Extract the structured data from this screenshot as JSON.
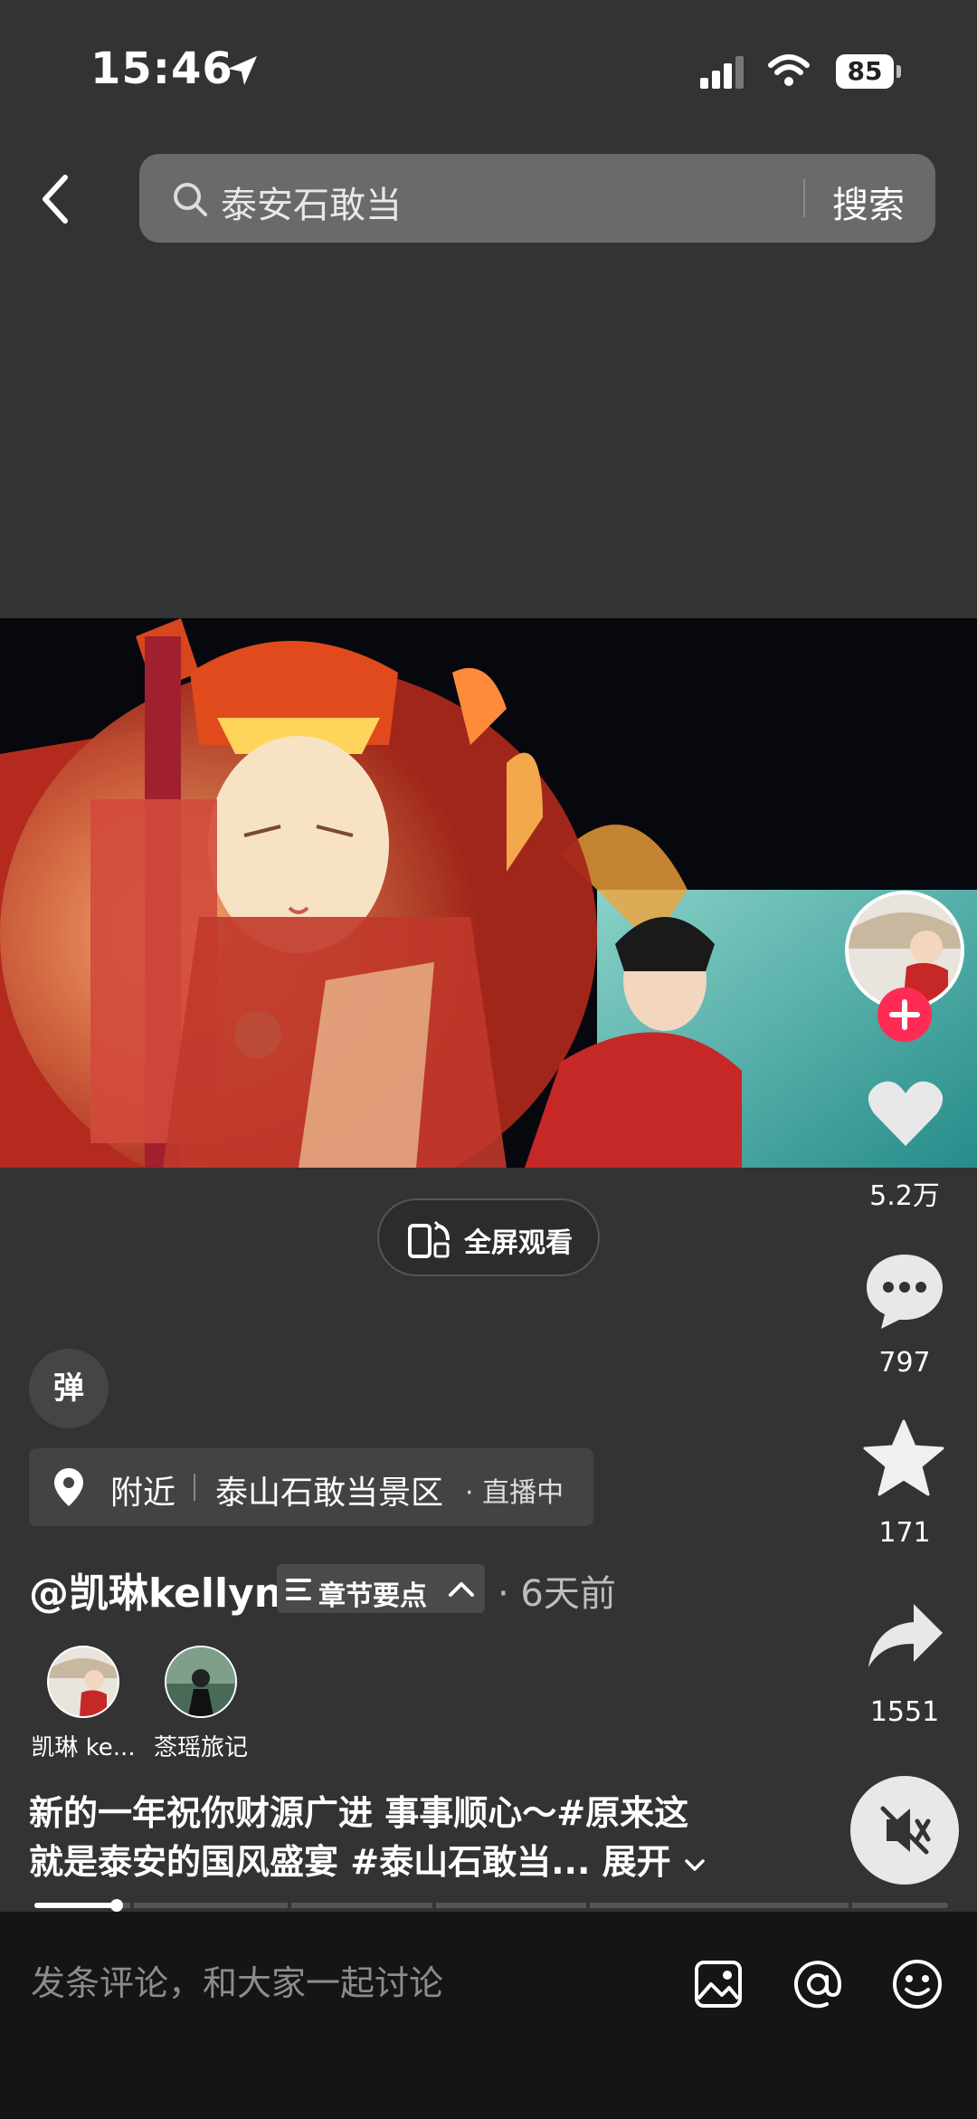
{
  "status_bar": {
    "time": "15:46",
    "battery": "85"
  },
  "search": {
    "query": "泰安石敢当",
    "button_label": "搜索"
  },
  "video": {
    "fullscreen_label": "全屏观看",
    "progress": 0.09
  },
  "actions": {
    "likes": "5.2万",
    "comments": "797",
    "favorites": "171",
    "shares": "1551"
  },
  "danmaku": {
    "label": "弹"
  },
  "location": {
    "nearby": "附近",
    "place": "泰山石敢当景区",
    "live": "· 直播中"
  },
  "post": {
    "author": "@凯琳kellyn",
    "chapters_label": "章节要点",
    "time_ago": "· 6天前",
    "collaborators": [
      {
        "name": "凯琳 ke..."
      },
      {
        "name": "菍瑶旅记"
      }
    ],
    "description_line1": "新的一年祝你财源广进 事事顺心～#原来这",
    "description_line2": "就是泰安的国风盛宴 #泰山石敢当...",
    "expand_label": "展开"
  },
  "comment_bar": {
    "placeholder": "发条评论，和大家一起讨论"
  },
  "colors": {
    "follow_badge": "#fe2c55",
    "bg": "#333333",
    "bottom_bar": "#151515"
  }
}
